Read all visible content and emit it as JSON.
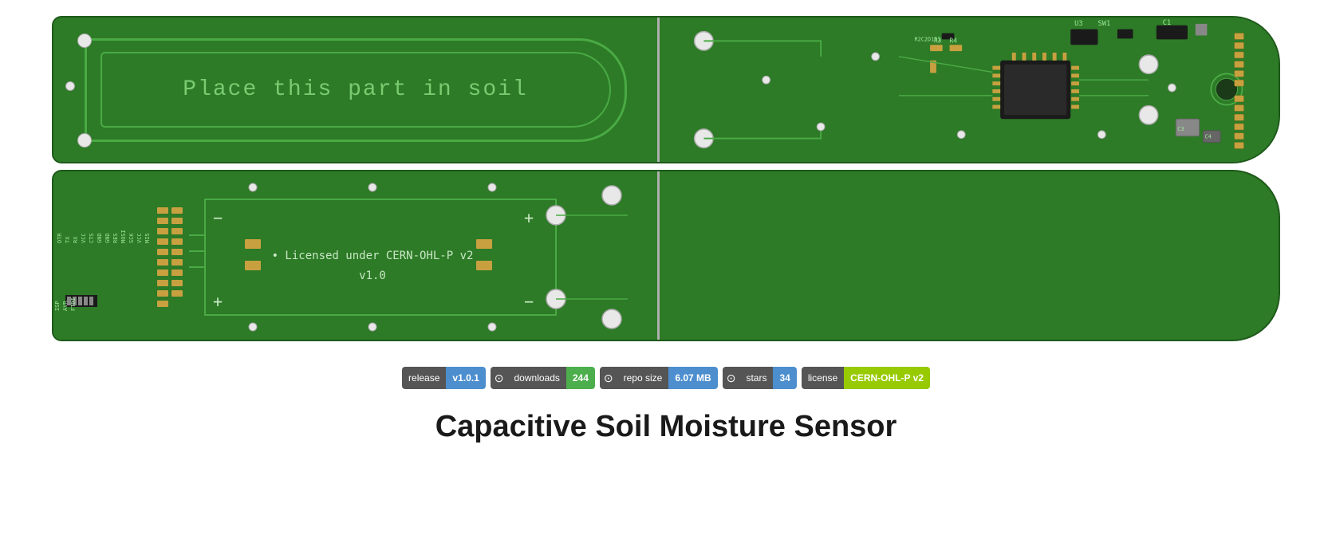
{
  "pcb": {
    "top_text": "Place this part in soil",
    "license_line1": "Licensed under CERN-OHL-P v2",
    "license_line2": "v1.0"
  },
  "badges": [
    {
      "label": "release",
      "value": "v1.0.1",
      "value_style": "blue",
      "has_icon": false
    },
    {
      "label": "downloads",
      "value": "244",
      "value_style": "green",
      "has_icon": true
    },
    {
      "label": "repo size",
      "value": "6.07 MB",
      "value_style": "blue",
      "has_icon": true
    },
    {
      "label": "stars",
      "value": "34",
      "value_style": "blue",
      "has_icon": true
    },
    {
      "label": "license",
      "value": "CERN-OHL-P v2",
      "value_style": "lime",
      "has_icon": false
    }
  ],
  "title": "Capacitive Soil Moisture Sensor",
  "colors": {
    "pcb_green": "#2d7a27",
    "pcb_trace": "#4aaa44",
    "badge_gray": "#555555",
    "badge_blue": "#4c8ece",
    "badge_green": "#4cae4c",
    "badge_lime": "#97ca00"
  }
}
